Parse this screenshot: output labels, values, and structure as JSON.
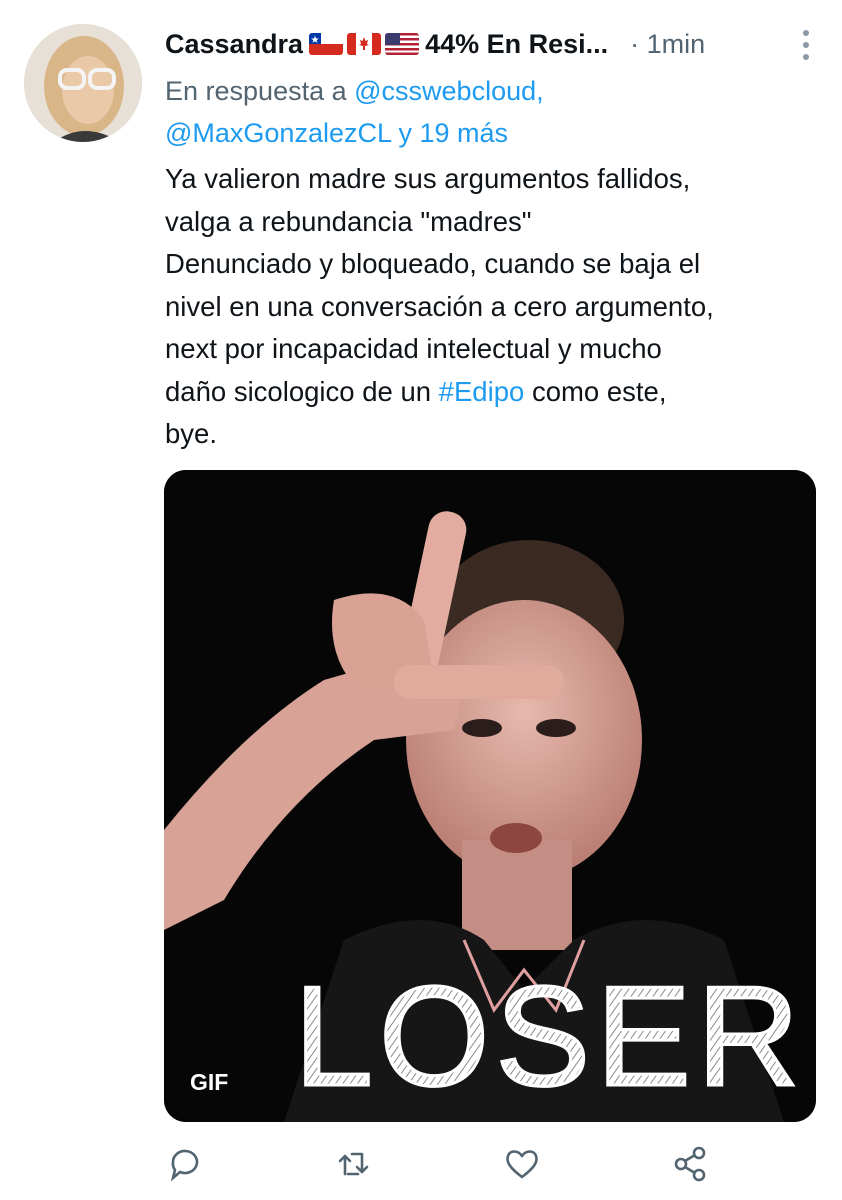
{
  "tweet": {
    "display_name": "Cassandra",
    "name_suffix": "44% En Resi...",
    "time": "· 1min",
    "flags": [
      "chile-flag",
      "canada-flag",
      "usa-flag"
    ],
    "reply_prefix": "En respuesta a ",
    "reply_mention_1": "@csswebcloud,",
    "reply_mention_2": "@MaxGonzalezCL",
    "reply_suffix": " y 19 más",
    "text_part1": "Ya valieron madre sus argumentos fallidos,\nvalga a rebundancia \"madres\"\nDenunciado y bloqueado, cuando se baja el\nnivel en una conversación a cero argumento,\nnext por incapacidad intelectual y mucho\ndaño sicologico de un ",
    "hashtag": "#Edipo",
    "text_part2": " como este,\nbye.",
    "media": {
      "gif_badge": "GIF",
      "overlay_text": "LOSER"
    }
  },
  "actions": [
    "reply-icon",
    "retweet-icon",
    "like-icon",
    "share-icon"
  ],
  "colors": {
    "link": "#1d9bf0",
    "secondary": "#536471",
    "icon": "#536471"
  }
}
